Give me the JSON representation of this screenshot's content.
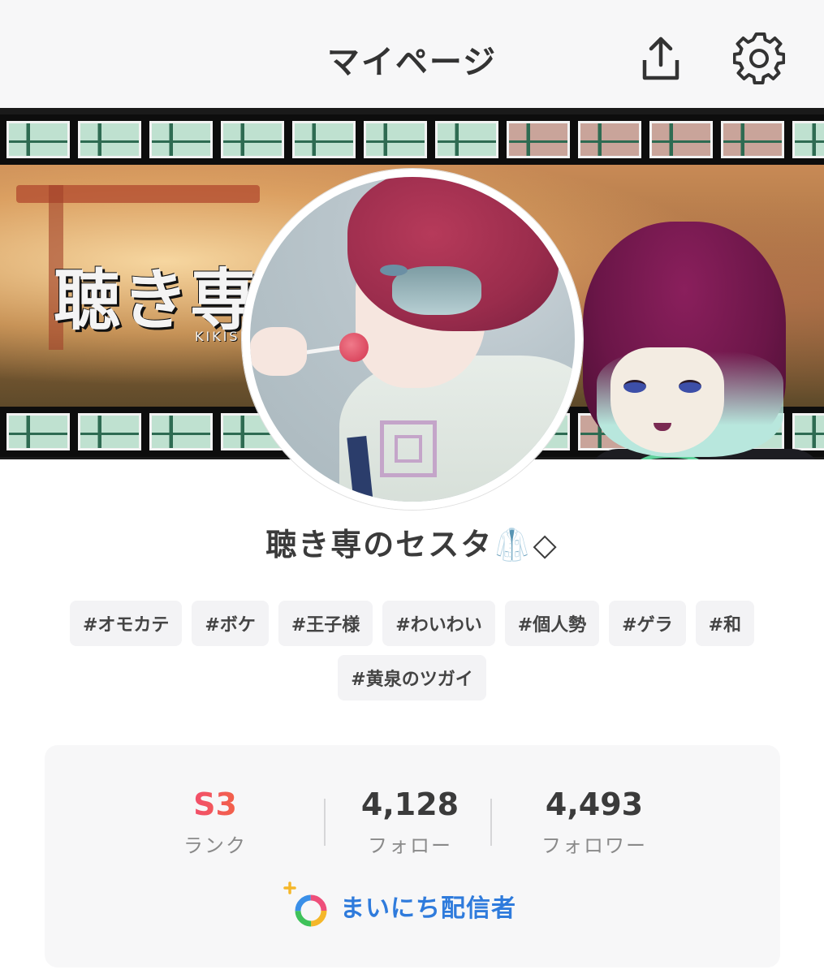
{
  "header": {
    "title": "マイページ",
    "share_icon": "share-upload-icon",
    "settings_icon": "gear-icon"
  },
  "banner": {
    "logo_text": "聴き専",
    "logo_sub": "KIKISEN"
  },
  "profile": {
    "name": "聴き専のセスタ🥼◇"
  },
  "tags": {
    "row1": [
      "#オモカテ",
      "#ボケ",
      "#王子様",
      "#わいわい",
      "#個人勢",
      "#ゲラ",
      "#和"
    ],
    "row2": [
      "#黄泉のツガイ"
    ]
  },
  "stats": {
    "rank_value": "S3",
    "rank_label": "ランク",
    "follow_value": "4,128",
    "follow_label": "フォロー",
    "follower_value": "4,493",
    "follower_label": "フォロワー"
  },
  "daily": {
    "label": "まいにち配信者"
  },
  "colors": {
    "accent_blue": "#2f7bdc",
    "rank_gradient_start": "#f2467a",
    "rank_gradient_end": "#f26a3a",
    "tag_bg": "#f3f3f5",
    "card_bg": "#f7f7f8"
  }
}
